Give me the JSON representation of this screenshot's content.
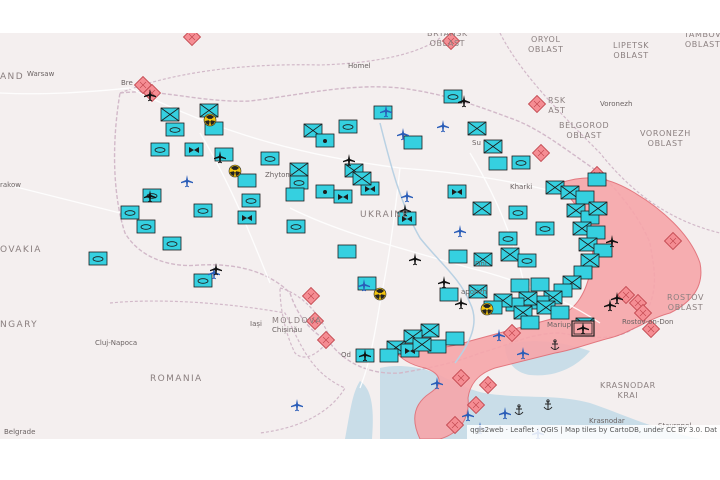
{
  "colors": {
    "land": "#f4efef",
    "sea": "#c9dde8",
    "occupied": "#f7a6aa",
    "occupied_border": "#e26c74",
    "unit_fill": "#35d0e0",
    "unit_border": "#1d1d1d",
    "diamond_fill": "#f58d93",
    "diamond_border": "#c2474f",
    "aircraft": "#2a5db8",
    "border_line": "#d2b9c9",
    "road": "#ffffff",
    "nuclear": "#f2c40f"
  },
  "map": {
    "countries": [
      {
        "label": "UKRAINE"
      },
      {
        "label": "ROMANIA"
      },
      {
        "label": "MOLDOVA"
      },
      {
        "label": "OVAKIA"
      },
      {
        "label": "NGARY"
      },
      {
        "label": "AND"
      }
    ],
    "regions": [
      {
        "label": "BRYANSK\nOBLAST"
      },
      {
        "label": "ORYOL\nOBLAST"
      },
      {
        "label": "LIPETSK\nOBLAST"
      },
      {
        "label": "TAMBOV\nOBLAST"
      },
      {
        "label": "RSK\nAST"
      },
      {
        "label": "BELGOROD\nOBLAST"
      },
      {
        "label": "VORONEZH\nOBLAST"
      },
      {
        "label": "ROSTOV\nOBLAST"
      },
      {
        "label": "KRASNODAR\nKRAI"
      }
    ],
    "cities": [
      {
        "label": "Homel"
      },
      {
        "label": "Warsaw"
      },
      {
        "label": "Bre"
      },
      {
        "label": "Voronezh"
      },
      {
        "label": "Zhytom"
      },
      {
        "label": "rakow"
      },
      {
        "label": "Iași"
      },
      {
        "label": "Chișinău"
      },
      {
        "label": "Cluj-Napoca"
      },
      {
        "label": "Kharki"
      },
      {
        "label": "Dni"
      },
      {
        "label": "aporizh"
      },
      {
        "label": "Mariup"
      },
      {
        "label": "Rostov-on-Don"
      },
      {
        "label": "Krasnodar"
      },
      {
        "label": "Stavropol"
      },
      {
        "label": "Belgrade"
      },
      {
        "label": "Od"
      },
      {
        "label": "Su"
      }
    ],
    "attribution": "qgis2web · Leaflet · QGIS | Map tiles by CartoDB, under CC BY 3.0. Dat"
  }
}
